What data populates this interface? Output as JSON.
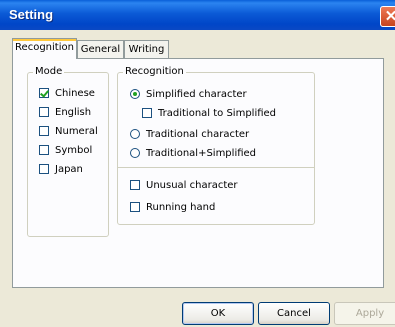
{
  "window": {
    "title": "Setting",
    "close_glyph": "✕"
  },
  "tabs": [
    {
      "label": "Recognition",
      "active": true
    },
    {
      "label": "General",
      "active": false
    },
    {
      "label": "Writing",
      "active": false
    }
  ],
  "mode": {
    "legend": "Mode",
    "items": [
      {
        "label": "Chinese",
        "checked": true
      },
      {
        "label": "English",
        "checked": false
      },
      {
        "label": "Numeral",
        "checked": false
      },
      {
        "label": "Symbol",
        "checked": false
      },
      {
        "label": "Japan",
        "checked": false
      }
    ]
  },
  "recognition": {
    "legend": "Recognition",
    "simplified": {
      "label": "Simplified character",
      "selected": true
    },
    "trad_to_simplified": {
      "label": "Traditional to Simplified",
      "checked": false
    },
    "traditional": {
      "label": "Traditional character",
      "selected": false
    },
    "trad_plus_simplified": {
      "label": "Traditional+Simplified",
      "selected": false
    },
    "unusual": {
      "label": "Unusual character",
      "checked": false
    },
    "running_hand": {
      "label": "Running hand",
      "checked": false
    }
  },
  "buttons": {
    "ok": "OK",
    "cancel": "Cancel",
    "apply": "Apply"
  },
  "colors": {
    "titlebar": "#0a5fd8",
    "face": "#ece9d8",
    "check": "#21a121"
  }
}
